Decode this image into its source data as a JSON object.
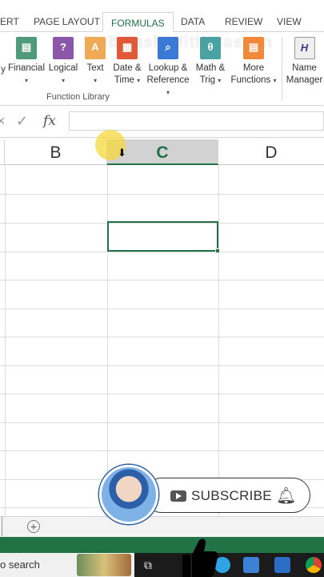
{
  "ribbon_tabs": [
    {
      "label": "ERT"
    },
    {
      "label": "PAGE LAYOUT"
    },
    {
      "label": "FORMULAS",
      "active": true
    },
    {
      "label": "DATA"
    },
    {
      "label": "REVIEW"
    },
    {
      "label": "VIEW"
    }
  ],
  "watermark": "Web Task With Hassan",
  "ribbon": {
    "buttons": [
      {
        "line1": "y",
        "line2": "",
        "icon": "autosum-icon"
      },
      {
        "line1": "Financial",
        "line2": "",
        "icon": "financial-icon",
        "color": "#4f9a78"
      },
      {
        "line1": "Logical",
        "line2": "",
        "icon": "logical-icon",
        "color": "#8b57a8"
      },
      {
        "line1": "Text",
        "line2": "",
        "icon": "text-icon",
        "color": "#f0a955"
      },
      {
        "line1": "Date &",
        "line2": "Time",
        "icon": "date-time-icon",
        "color": "#e05a3a"
      },
      {
        "line1": "Lookup &",
        "line2": "Reference",
        "icon": "lookup-icon",
        "color": "#3a7ad6"
      },
      {
        "line1": "Math &",
        "line2": "Trig",
        "icon": "math-trig-icon",
        "color": "#4aa3a0"
      },
      {
        "line1": "More",
        "line2": "Functions",
        "icon": "more-functions-icon",
        "color": "#f08a3a"
      },
      {
        "line1": "Name",
        "line2": "Manager",
        "icon": "name-manager-icon"
      }
    ],
    "group_label": "Function Library"
  },
  "formula_bar": {
    "fx": "fx",
    "value": ""
  },
  "columns": [
    "B",
    "C",
    "D"
  ],
  "selected_column": "C",
  "subscribe_label": "SUBSCRIBE",
  "taskbar": {
    "search_text": "o search"
  },
  "colors": {
    "excel_green": "#217346",
    "accent_tab": "#217346"
  }
}
